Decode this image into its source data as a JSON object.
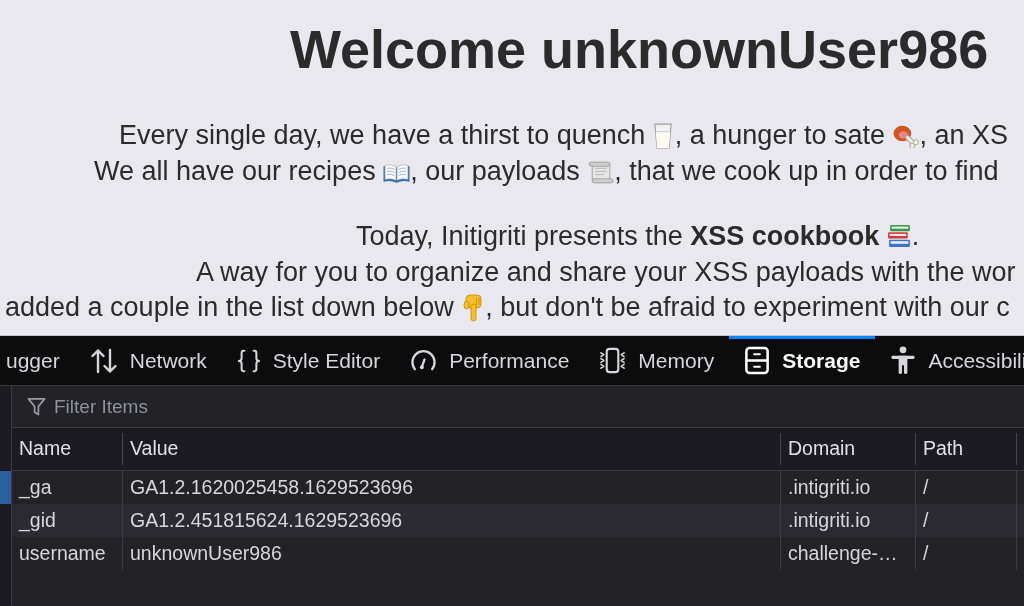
{
  "page": {
    "title": "Welcome unknownUser986",
    "paragraphs": [
      {
        "lines": [
          [
            "Every single day, we have a thirst to quench ",
            ", a hunger to sate ",
            ", an XS"
          ],
          [
            "We all have our recipes ",
            ", our payloads ",
            ", that we cook up in order to find"
          ]
        ]
      },
      {
        "lines": [
          [
            "Today, Initigriti presents the **XSS cookbook** ",
            "."
          ],
          [
            "A way for you to organize and share your XSS payloads with the wor"
          ],
          [
            "added a couple in the list down below ",
            ", but don't be afraid to experiment with our c"
          ]
        ]
      }
    ]
  },
  "devtools": {
    "tabs": [
      {
        "label": "ugger",
        "selected": false
      },
      {
        "label": "Network",
        "selected": false
      },
      {
        "label": "Style Editor",
        "selected": false
      },
      {
        "label": "Performance",
        "selected": false
      },
      {
        "label": "Memory",
        "selected": false
      },
      {
        "label": "Storage",
        "selected": true
      },
      {
        "label": "Accessibili",
        "selected": false
      }
    ],
    "sidebar": {
      "items": [
        {
          "selected": true
        }
      ]
    },
    "filter": {
      "placeholder": "Filter Items"
    },
    "table": {
      "columns": [
        "Name",
        "Value",
        "Domain",
        "Path"
      ],
      "rows": [
        [
          "_ga",
          "GA1.2.1620025458.1629523696",
          ".intigriti.io",
          "/"
        ],
        [
          "_gid",
          "GA1.2.451815624.1629523696",
          ".intigriti.io",
          "/"
        ],
        [
          "username",
          "unknownUser986",
          "challenge-…",
          "/"
        ]
      ]
    }
  }
}
